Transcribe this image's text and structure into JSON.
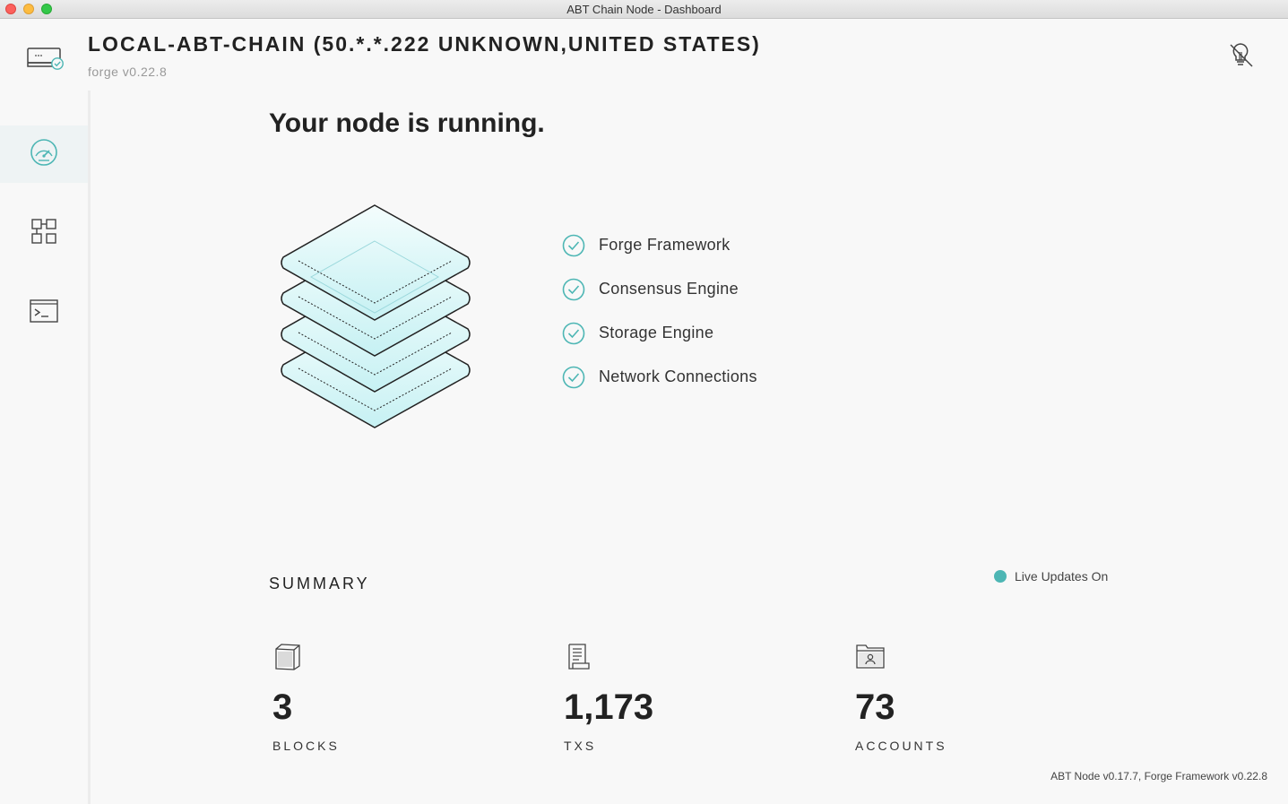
{
  "window": {
    "title": "ABT Chain Node - Dashboard"
  },
  "header": {
    "node_name": "LOCAL-ABT-CHAIN (50.*.*.222 UNKNOWN,UNITED STATES)",
    "forge_version": "forge v0.22.8",
    "node_icon": "node-status-icon",
    "toggle_icon": "lightbulb-off-icon"
  },
  "sidebar": {
    "items": [
      {
        "icon": "dashboard-gauge-icon",
        "active": true
      },
      {
        "icon": "blocks-grid-icon",
        "active": false
      },
      {
        "icon": "terminal-icon",
        "active": false
      }
    ]
  },
  "main": {
    "status_title": "Your node is running.",
    "checklist": [
      {
        "label": "Forge Framework",
        "status": "ok"
      },
      {
        "label": "Consensus Engine",
        "status": "ok"
      },
      {
        "label": "Storage Engine",
        "status": "ok"
      },
      {
        "label": "Network Connections",
        "status": "ok"
      }
    ],
    "summary": {
      "title": "SUMMARY",
      "live_label": "Live Updates On",
      "stats": [
        {
          "value": "3",
          "label": "BLOCKS",
          "icon": "cube-icon"
        },
        {
          "value": "1,173",
          "label": "TXS",
          "icon": "receipt-icon"
        },
        {
          "value": "73",
          "label": "ACCOUNTS",
          "icon": "folder-user-icon"
        }
      ]
    },
    "footer_version": "ABT Node v0.17.7, Forge Framework v0.22.8"
  },
  "colors": {
    "accent": "#4db6b4",
    "text": "#222222",
    "muted": "#999999"
  }
}
